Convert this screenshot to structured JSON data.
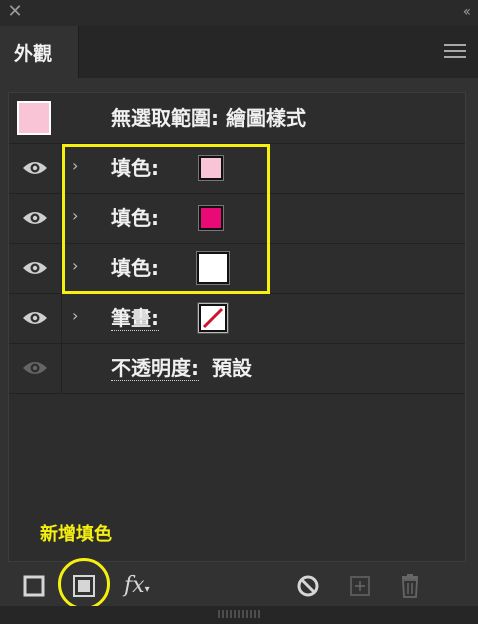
{
  "panel": {
    "tab_label": "外觀"
  },
  "header_row": {
    "label": "無選取範圍: 繪圖樣式",
    "swatch_color": "#f9c4d6"
  },
  "rows": [
    {
      "label": "填色:",
      "swatch_color": "#f9c4d6",
      "visible": true
    },
    {
      "label": "填色:",
      "swatch_color": "#ea0a76",
      "visible": true
    },
    {
      "label": "填色:",
      "swatch_color": "#ffffff",
      "visible": true
    },
    {
      "label": "筆畫:",
      "swatch": "none-stroke",
      "visible": true
    }
  ],
  "opacity_row": {
    "label": "不透明度:",
    "value": "預設"
  },
  "hint": {
    "label": "新增填色",
    "color": "#f5f010"
  },
  "toolbar": {
    "fx_label": "fx"
  }
}
